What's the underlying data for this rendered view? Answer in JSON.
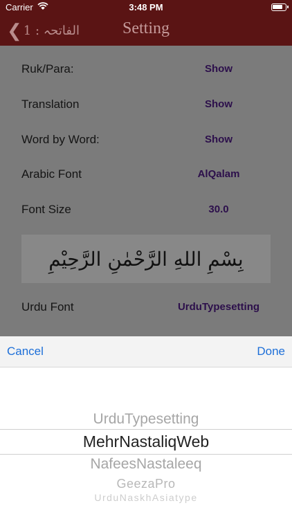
{
  "status_bar": {
    "carrier": "Carrier",
    "time": "3:48 PM",
    "battery_level": 0.8
  },
  "nav": {
    "back_label": "الفاتحہ : 1",
    "title": "Setting"
  },
  "settings": [
    {
      "label": "Ruk/Para:",
      "value": "Show"
    },
    {
      "label": "Translation",
      "value": "Show"
    },
    {
      "label": "Word by Word:",
      "value": "Show"
    },
    {
      "label": "Arabic Font",
      "value": "AlQalam"
    },
    {
      "label": "Font Size",
      "value": "30.0"
    }
  ],
  "preview_text": "بِسْمِ اللهِ الرَّحْمٰنِ الرَّحِيْمِ",
  "urdu_font": {
    "label": "Urdu Font",
    "value": "UrduTypesetting"
  },
  "picker": {
    "cancel_label": "Cancel",
    "done_label": "Done",
    "options": [
      "UrduTypesetting",
      "MehrNastaliqWeb",
      "NafeesNastaleeq",
      "GeezaPro",
      "UrduNaskhAsiatype"
    ],
    "selected": "MehrNastaliqWeb"
  },
  "colors": {
    "nav_bg": "#5a1414",
    "dim_overlay": "#7b7b7b",
    "value_text": "#2c0f4b",
    "link_blue": "#1d6fd8"
  },
  "icons": {
    "signal": "wifi-icon",
    "battery": "battery-icon",
    "back": "chevron-left-icon"
  }
}
